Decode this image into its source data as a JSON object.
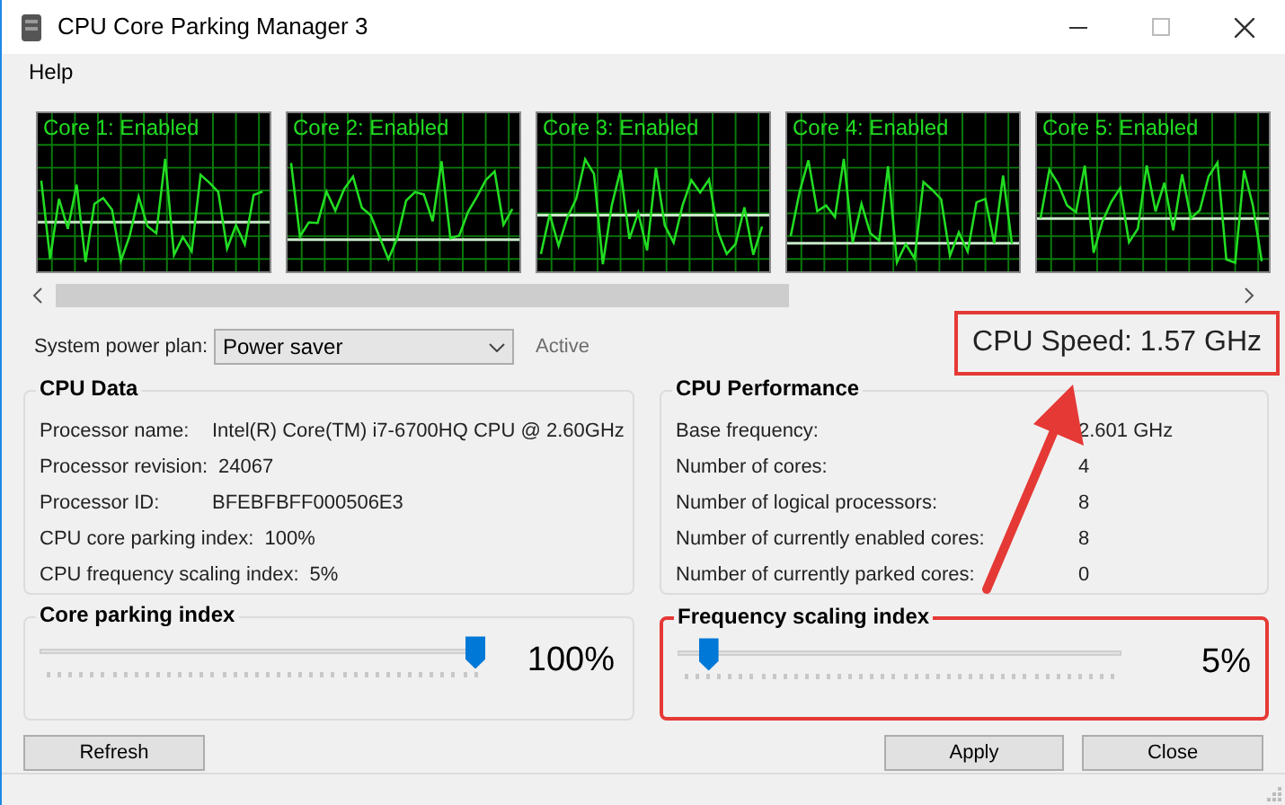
{
  "window": {
    "title": "CPU Core Parking Manager 3"
  },
  "menu": [
    "Help"
  ],
  "cores": [
    {
      "label": "Core 1: Enabled"
    },
    {
      "label": "Core 2: Enabled"
    },
    {
      "label": "Core 3: Enabled"
    },
    {
      "label": "Core 4: Enabled"
    },
    {
      "label": "Core 5: Enabled"
    }
  ],
  "power_plan": {
    "label": "System power plan:",
    "value": "Power saver",
    "status": "Active"
  },
  "cpu_speed": "CPU Speed: 1.57 GHz",
  "cpu_data": {
    "title": "CPU Data",
    "rows": [
      {
        "label": "Processor name:",
        "value": "Intel(R) Core(TM) i7-6700HQ CPU @ 2.60GHz"
      },
      {
        "label": "Processor revision:",
        "value": "24067"
      },
      {
        "label": "Processor ID:",
        "value": "BFEBFBFF000506E3"
      },
      {
        "label": "CPU core parking index:",
        "value": "100%"
      },
      {
        "label": "CPU frequency scaling index:",
        "value": "5%"
      }
    ]
  },
  "cpu_performance": {
    "title": "CPU Performance",
    "rows": [
      {
        "label": "Base frequency:",
        "value": "2.601 GHz"
      },
      {
        "label": "Number of cores:",
        "value": "4"
      },
      {
        "label": "Number of logical processors:",
        "value": "8"
      },
      {
        "label": "Number of currently enabled cores:",
        "value": "8"
      },
      {
        "label": "Number of currently parked cores:",
        "value": "0"
      }
    ]
  },
  "sliders": [
    {
      "title": "Core parking index",
      "level": 1.0,
      "reading": "100%",
      "highlighted": false
    },
    {
      "title": "Frequency scaling index",
      "level": 0.05,
      "reading": "5%",
      "highlighted": true
    }
  ],
  "buttons": {
    "refresh": "Refresh",
    "apply": "Apply",
    "close": "Close"
  }
}
